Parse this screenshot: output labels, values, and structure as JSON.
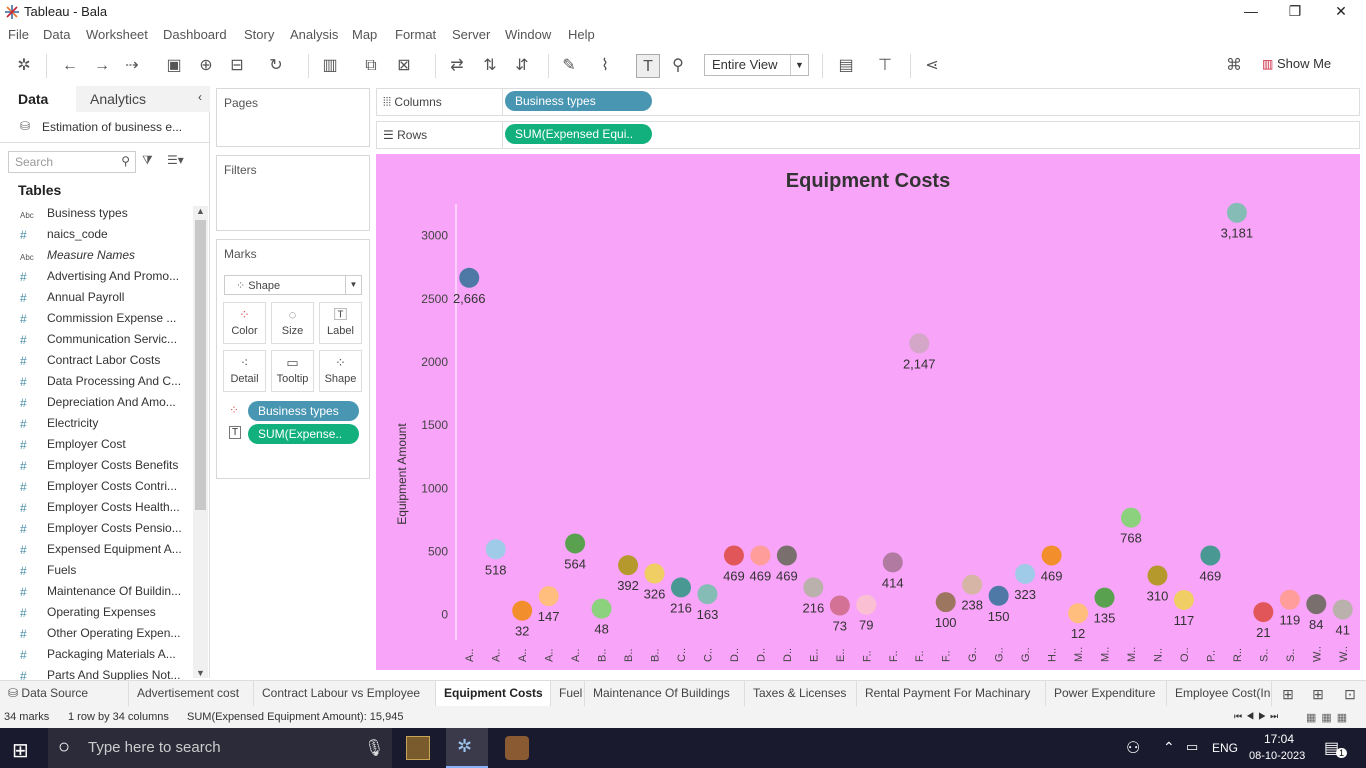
{
  "window": {
    "title": "Tableau - Bala",
    "minimize": "—",
    "restore": "❐",
    "close": "✕"
  },
  "menu": [
    "File",
    "Data",
    "Worksheet",
    "Dashboard",
    "Story",
    "Analysis",
    "Map",
    "Format",
    "Server",
    "Window",
    "Help"
  ],
  "toolbar": {
    "fit_value": "Entire View",
    "show_me": "Show Me"
  },
  "data_pane": {
    "tab_data": "Data",
    "tab_analytics": "Analytics",
    "datasource": "Estimation of business e...",
    "search_placeholder": "Search",
    "tables_heading": "Tables",
    "fields": [
      {
        "type": "Abc",
        "name": "Business types"
      },
      {
        "type": "#",
        "name": "naics_code"
      },
      {
        "type": "Abc",
        "name": "Measure Names",
        "italic": true
      },
      {
        "type": "#",
        "name": "Advertising And Promo..."
      },
      {
        "type": "#",
        "name": "Annual Payroll"
      },
      {
        "type": "#",
        "name": "Commission Expense ..."
      },
      {
        "type": "#",
        "name": "Communication Servic..."
      },
      {
        "type": "#",
        "name": "Contract Labor Costs"
      },
      {
        "type": "#",
        "name": "Data Processing And C..."
      },
      {
        "type": "#",
        "name": "Depreciation And Amo..."
      },
      {
        "type": "#",
        "name": "Electricity"
      },
      {
        "type": "#",
        "name": "Employer Cost"
      },
      {
        "type": "#",
        "name": "Employer Costs Benefits"
      },
      {
        "type": "#",
        "name": "Employer Costs Contri..."
      },
      {
        "type": "#",
        "name": "Employer Costs Health..."
      },
      {
        "type": "#",
        "name": "Employer Costs Pensio..."
      },
      {
        "type": "#",
        "name": "Expensed Equipment A..."
      },
      {
        "type": "#",
        "name": "Fuels"
      },
      {
        "type": "#",
        "name": "Maintenance Of Buildin..."
      },
      {
        "type": "#",
        "name": "Operating Expenses"
      },
      {
        "type": "#",
        "name": "Other Operating Expen..."
      },
      {
        "type": "#",
        "name": "Packaging Materials A..."
      },
      {
        "type": "#",
        "name": "Parts And Supplies Not..."
      }
    ]
  },
  "pages": {
    "title": "Pages"
  },
  "filters": {
    "title": "Filters"
  },
  "marks": {
    "title": "Marks",
    "mark_type": "Shape",
    "buttons": [
      "Color",
      "Size",
      "Label",
      "Detail",
      "Tooltip",
      "Shape"
    ],
    "pill_color": "Business types",
    "pill_label": "SUM(Expense.."
  },
  "shelves": {
    "columns_label": "Columns",
    "columns_pill": "Business types",
    "rows_label": "Rows",
    "rows_pill": "SUM(Expensed Equi.."
  },
  "chart_data": {
    "type": "scatter",
    "title": "Equipment Costs",
    "xlabel": "",
    "ylabel": "Equipment Amount",
    "ylim": [
      -200,
      3250
    ],
    "yticks": [
      0,
      500,
      1000,
      1500,
      2000,
      2500,
      3000
    ],
    "background": "#f8a4f8",
    "categories": [
      "A..",
      "A..",
      "A..",
      "A..",
      "A..",
      "B..",
      "B..",
      "B..",
      "C..",
      "C..",
      "D..",
      "D..",
      "D..",
      "E..",
      "E..",
      "F..",
      "F..",
      "F..",
      "F..",
      "G..",
      "G..",
      "G..",
      "H..",
      "M..",
      "M..",
      "M..",
      "N..",
      "O..",
      "P..",
      "R..",
      "S..",
      "S..",
      "W..",
      "W.."
    ],
    "values": [
      2666,
      518,
      32,
      147,
      564,
      48,
      392,
      326,
      216,
      163,
      469,
      469,
      469,
      216,
      73,
      79,
      414,
      2147,
      100,
      238,
      150,
      323,
      469,
      12,
      135,
      768,
      310,
      117,
      469,
      3181,
      21,
      119,
      84,
      41
    ],
    "labels": [
      "2,666",
      "518",
      "32",
      "147",
      "564",
      "48",
      "392",
      "326",
      "216",
      "163",
      "469",
      "469",
      "469",
      "216",
      "73",
      "79",
      "414",
      "2,147",
      "100",
      "238",
      "150",
      "323",
      "469",
      "12",
      "135",
      "768",
      "310",
      "117",
      "469",
      "3,181",
      "21",
      "119",
      "84",
      "41"
    ],
    "colors": [
      "#4e79a7",
      "#a0cbe8",
      "#f28e2b",
      "#ffbe7d",
      "#59a14f",
      "#8cd17d",
      "#b6992d",
      "#f1ce63",
      "#499894",
      "#86bcb6",
      "#e15759",
      "#ff9d9a",
      "#79706e",
      "#bab0ac",
      "#d37295",
      "#fabfd2",
      "#b07aa1",
      "#d4a6c8",
      "#9d7660",
      "#d7b5a6",
      "#4e79a7",
      "#a0cbe8",
      "#f28e2b",
      "#ffbe7d",
      "#59a14f",
      "#8cd17d",
      "#b6992d",
      "#f1ce63",
      "#499894",
      "#86bcb6",
      "#e15759",
      "#ff9d9a",
      "#79706e",
      "#bab0ac"
    ]
  },
  "sheet_tabs": [
    "Data Source",
    "Advertisement cost",
    "Contract Labour vs Employee",
    "Equipment Costs",
    "Fuel",
    "Maintenance Of Buildings",
    "Taxes & Licenses",
    "Rental Payment For Machinary",
    "Power Expenditure",
    "Employee Cost(In"
  ],
  "active_sheet": "Equipment Costs",
  "status": {
    "marks": "34 marks",
    "shape": "1 row by 34 columns",
    "sum": "SUM(Expensed Equipment Amount): 15,945"
  },
  "taskbar": {
    "search_placeholder": "Type here to search",
    "lang": "ENG",
    "time": "17:04",
    "date": "08-10-2023",
    "notif_count": "1"
  }
}
